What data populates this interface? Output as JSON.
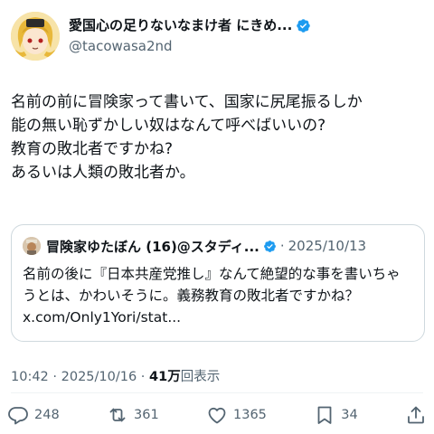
{
  "author": {
    "display_name": "愛国心の足りないなまけ者 にきめ...",
    "handle": "@tacowasa2nd"
  },
  "tweet": {
    "text": "名前の前に冒険家って書いて、国家に尻尾振るしか\n能の無い恥ずかしい奴はなんて呼べばいいの?\n教育の敗北者ですかね?\nあるいは人類の敗北者か。"
  },
  "quote": {
    "display_name": "冒険家ゆたぼん (16)@スタディ...",
    "separator": "·",
    "date": "2025/10/13",
    "text": "名前の後に『日本共産党推し』なんて絶望的な事を書いちゃうとは、かわいそうに。義務教育の敗北者ですかね？ x.com/Only1Yori/stat..."
  },
  "meta": {
    "time": "10:42",
    "separator": " · ",
    "date": "2025/10/16",
    "separator2": " · ",
    "views_count": "41万",
    "views_label": "回表示"
  },
  "actions": {
    "replies": "248",
    "reposts": "361",
    "likes": "1365",
    "bookmarks": "34",
    "icons": [
      "reply-icon",
      "repost-icon",
      "like-icon",
      "bookmark-icon",
      "share-icon"
    ]
  },
  "colors": {
    "verified": "#1d9bf0",
    "text_secondary": "#536471",
    "border": "#cfd9de"
  }
}
